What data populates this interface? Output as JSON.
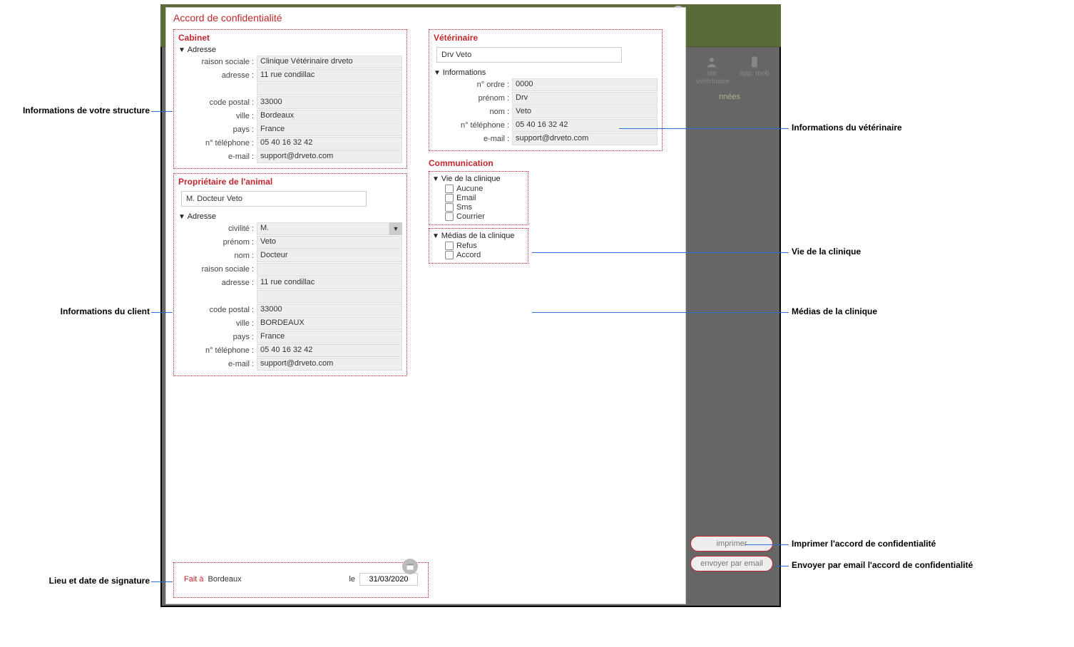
{
  "modal": {
    "title": "Accord de confidentialité"
  },
  "cabinet": {
    "title": "Cabinet",
    "adresse_head": "Adresse",
    "labels": {
      "raison": "raison sociale :",
      "adresse": "adresse :",
      "cp": "code postal :",
      "ville": "ville :",
      "pays": "pays :",
      "tel": "n° téléphone :",
      "email": "e-mail :"
    },
    "values": {
      "raison": "Clinique Vétérinaire drveto",
      "adresse": "11 rue condillac",
      "adresse2": "",
      "cp": "33000",
      "ville": "Bordeaux",
      "pays": "France",
      "tel": "05 40 16 32 42",
      "email": "support@drveto.com"
    }
  },
  "owner": {
    "title": "Propriétaire de l'animal",
    "name": "M. Docteur Veto",
    "adresse_head": "Adresse",
    "labels": {
      "civ": "civilité :",
      "prenom": "prénom :",
      "nom": "nom :",
      "raison": "raison sociale :",
      "adresse": "adresse :",
      "cp": "code postal :",
      "ville": "ville :",
      "pays": "pays :",
      "tel": "n° téléphone :",
      "email": "e-mail :"
    },
    "values": {
      "civ": "M.",
      "prenom": "Veto",
      "nom": "Docteur",
      "raison": "",
      "adresse": "11 rue condillac",
      "adresse2": "",
      "cp": "33000",
      "ville": "BORDEAUX",
      "pays": "France",
      "tel": "05 40 16 32 42",
      "email": "support@drveto.com"
    }
  },
  "vet": {
    "title": "Vétérinaire",
    "name": "Drv Veto",
    "info_head": "Informations",
    "labels": {
      "ordre": "n° ordre :",
      "prenom": "prénom :",
      "nom": "nom :",
      "tel": "n° téléphone :",
      "email": "e-mail :"
    },
    "values": {
      "ordre": "0000",
      "prenom": "Drv",
      "nom": "Veto",
      "tel": "05 40 16 32 42",
      "email": "support@drveto.com"
    }
  },
  "comm": {
    "title": "Communication",
    "vie_head": "Vie de la clinique",
    "vie_opts": {
      "aucune": "Aucune",
      "email": "Email",
      "sms": "Sms",
      "courrier": "Courrier"
    },
    "media_head": "Médias de la clinique",
    "media_opts": {
      "refus": "Refus",
      "accord": "Accord"
    }
  },
  "signature": {
    "fait_a": "Fait à",
    "lieu": "Bordeaux",
    "le": "le",
    "date": "31/03/2020"
  },
  "buttons": {
    "print": "imprimer",
    "email": "envoyer par email"
  },
  "bg": {
    "vet": "ste vétérinaire",
    "mob": "app. mob",
    "donnees": "nnées"
  },
  "annotations": {
    "struct": "Informations de votre structure",
    "client": "Informations du client",
    "sig": "Lieu et date de signature",
    "vet": "Informations du vétérinaire",
    "vie": "Vie de la clinique",
    "media": "Médias de la clinique",
    "print": "Imprimer l'accord de confidentialité",
    "email": "Envoyer par email l'accord de confidentialité"
  }
}
